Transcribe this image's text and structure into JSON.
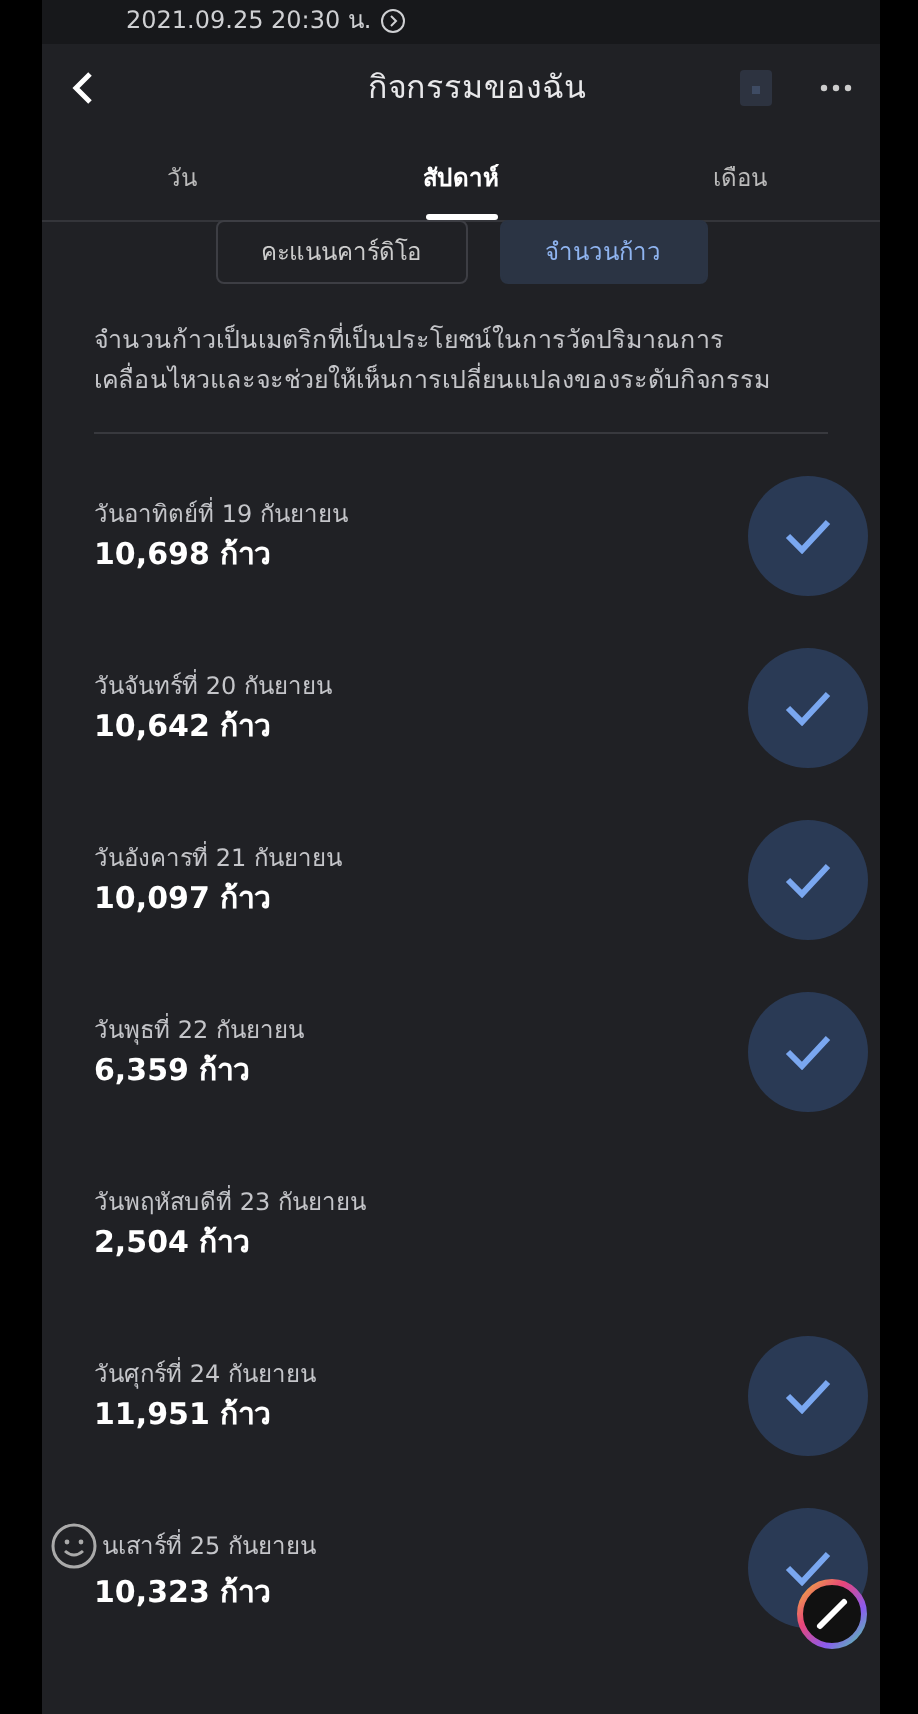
{
  "status_bar": {
    "text": "2021.09.25 20:30 น."
  },
  "header": {
    "title": "กิจกรรมของฉัน"
  },
  "tabs": [
    {
      "label": "วัน",
      "selected": false
    },
    {
      "label": "สัปดาห์",
      "selected": true
    },
    {
      "label": "เดือน",
      "selected": false
    }
  ],
  "toggle": [
    {
      "label": "คะแนนคาร์ดิโอ",
      "selected": false
    },
    {
      "label": "จำนวนก้าว",
      "selected": true
    }
  ],
  "description": "จำนวนก้าวเป็นเมตริกที่เป็นประโยชน์ในการวัดปริมาณการเคลื่อนไหวและจะช่วยให้เห็นการเปลี่ยนแปลงของระดับกิจกรรม",
  "days": [
    {
      "date": "วันอาทิตย์ที่ 19 กันยายน",
      "steps": "10,698 ก้าว",
      "goal_met": true
    },
    {
      "date": "วันจันทร์ที่ 20 กันยายน",
      "steps": "10,642 ก้าว",
      "goal_met": true
    },
    {
      "date": "วันอังคารที่ 21 กันยายน",
      "steps": "10,097 ก้าว",
      "goal_met": true
    },
    {
      "date": "วันพุธที่ 22 กันยายน",
      "steps": "6,359 ก้าว",
      "goal_met": true
    },
    {
      "date": "วันพฤหัสบดีที่ 23 กันยายน",
      "steps": "2,504 ก้าว",
      "goal_met": false
    },
    {
      "date": "วันศุกร์ที่ 24 กันยายน",
      "steps": "11,951 ก้าว",
      "goal_met": true
    },
    {
      "date": "นเสาร์ที่ 25 กันยายน",
      "steps": "10,323 ก้าว",
      "goal_met": true
    }
  ]
}
